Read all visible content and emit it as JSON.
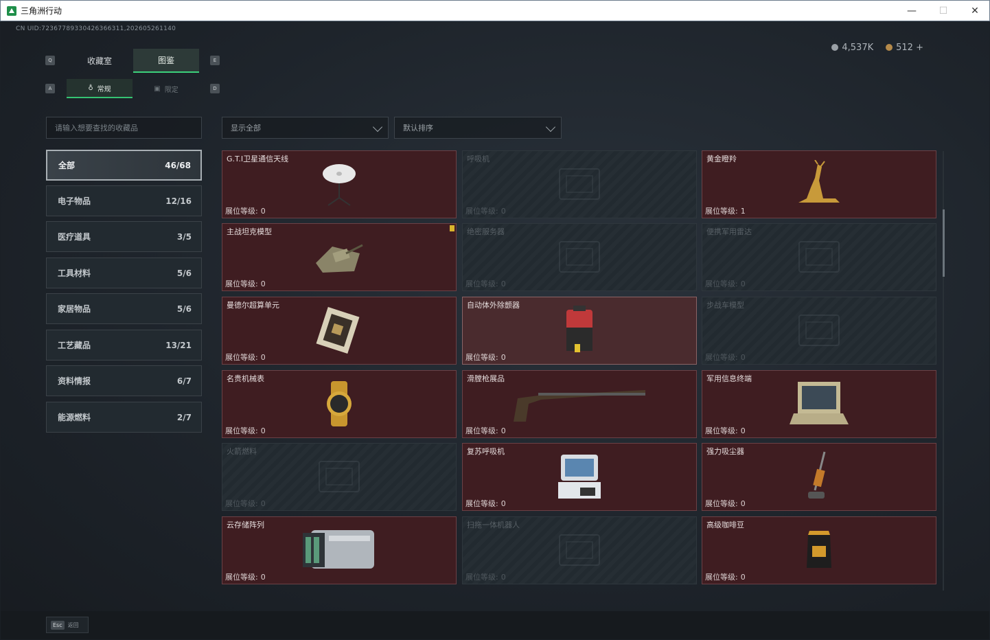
{
  "window": {
    "title": "三角洲行动",
    "minimize": "—",
    "maximize": "☐",
    "close": "✕"
  },
  "header": {
    "uid": "CN UID:72367789330426366311,202605261140",
    "currency": [
      {
        "icon": "silver-coin-icon",
        "value": "4,537K",
        "color": "#9aa0a6"
      },
      {
        "icon": "gold-coin-icon",
        "value": "512",
        "color": "#b58a4a",
        "plus": "+"
      }
    ]
  },
  "keys": {
    "q": "Q",
    "e": "E",
    "a": "A",
    "d": "D"
  },
  "tabs": [
    {
      "label": "收藏室",
      "active": false
    },
    {
      "label": "图鉴",
      "active": true
    }
  ],
  "subtabs": [
    {
      "label": "常规",
      "icon": "flask-icon",
      "active": true
    },
    {
      "label": "限定",
      "icon": "limited-icon",
      "active": false
    }
  ],
  "search": {
    "placeholder": "请输入想要查找的收藏品"
  },
  "filters": {
    "show": "显示全部",
    "sort": "默认排序"
  },
  "categories": [
    {
      "label": "全部",
      "count": "46/68",
      "active": true
    },
    {
      "label": "电子物品",
      "count": "12/16"
    },
    {
      "label": "医疗道具",
      "count": "3/5"
    },
    {
      "label": "工具材料",
      "count": "5/6"
    },
    {
      "label": "家居物品",
      "count": "5/6"
    },
    {
      "label": "工艺藏品",
      "count": "13/21"
    },
    {
      "label": "资料情报",
      "count": "6/7"
    },
    {
      "label": "能源燃料",
      "count": "2/7"
    }
  ],
  "items": [
    {
      "name": "G.T.I卫星通信天线",
      "level_label": "展位等级:",
      "level": "0",
      "state": "owned",
      "icon": "satellite-dish-icon"
    },
    {
      "name": "呼吸机",
      "level_label": "展位等级:",
      "level": "0",
      "state": "locked",
      "icon": "ventilator-icon"
    },
    {
      "name": "黄金瞪羚",
      "level_label": "展位等级:",
      "level": "1",
      "state": "owned",
      "icon": "golden-gazelle-icon"
    },
    {
      "name": "主战坦克模型",
      "level_label": "展位等级:",
      "level": "0",
      "state": "owned",
      "icon": "tank-model-icon",
      "badge": true
    },
    {
      "name": "绝密服务器",
      "level_label": "展位等级:",
      "level": "0",
      "state": "locked",
      "icon": "server-icon"
    },
    {
      "name": "便携军用雷达",
      "level_label": "展位等级:",
      "level": "0",
      "state": "locked",
      "icon": "radar-icon"
    },
    {
      "name": "曼德尔超算单元",
      "level_label": "展位等级:",
      "level": "0",
      "state": "owned",
      "icon": "compute-unit-icon"
    },
    {
      "name": "自动体外除颤器",
      "level_label": "展位等级:",
      "level": "0",
      "state": "owned-hl",
      "icon": "defibrillator-icon"
    },
    {
      "name": "步战车模型",
      "level_label": "展位等级:",
      "level": "0",
      "state": "locked",
      "icon": "ifv-model-icon"
    },
    {
      "name": "名贵机械表",
      "level_label": "展位等级:",
      "level": "0",
      "state": "owned",
      "icon": "watch-icon"
    },
    {
      "name": "滑膛枪展品",
      "level_label": "展位等级:",
      "level": "0",
      "state": "owned",
      "icon": "musket-icon"
    },
    {
      "name": "军用信息终端",
      "level_label": "展位等级:",
      "level": "0",
      "state": "owned",
      "icon": "terminal-icon"
    },
    {
      "name": "火箭燃料",
      "level_label": "展位等级:",
      "level": "0",
      "state": "locked",
      "icon": "rocket-fuel-icon"
    },
    {
      "name": "复苏呼吸机",
      "level_label": "展位等级:",
      "level": "0",
      "state": "owned",
      "icon": "resuscitator-icon"
    },
    {
      "name": "强力吸尘器",
      "level_label": "展位等级:",
      "level": "0",
      "state": "owned",
      "icon": "vacuum-icon"
    },
    {
      "name": "云存储阵列",
      "level_label": "展位等级:",
      "level": "0",
      "state": "owned",
      "icon": "storage-array-icon"
    },
    {
      "name": "扫拖一体机器人",
      "level_label": "展位等级:",
      "level": "0",
      "state": "locked",
      "icon": "robot-vacuum-icon"
    },
    {
      "name": "高级咖啡豆",
      "level_label": "展位等级:",
      "level": "0",
      "state": "owned",
      "icon": "coffee-bag-icon"
    }
  ],
  "footer": {
    "esc_key": "Esc",
    "esc_label": "返回"
  }
}
